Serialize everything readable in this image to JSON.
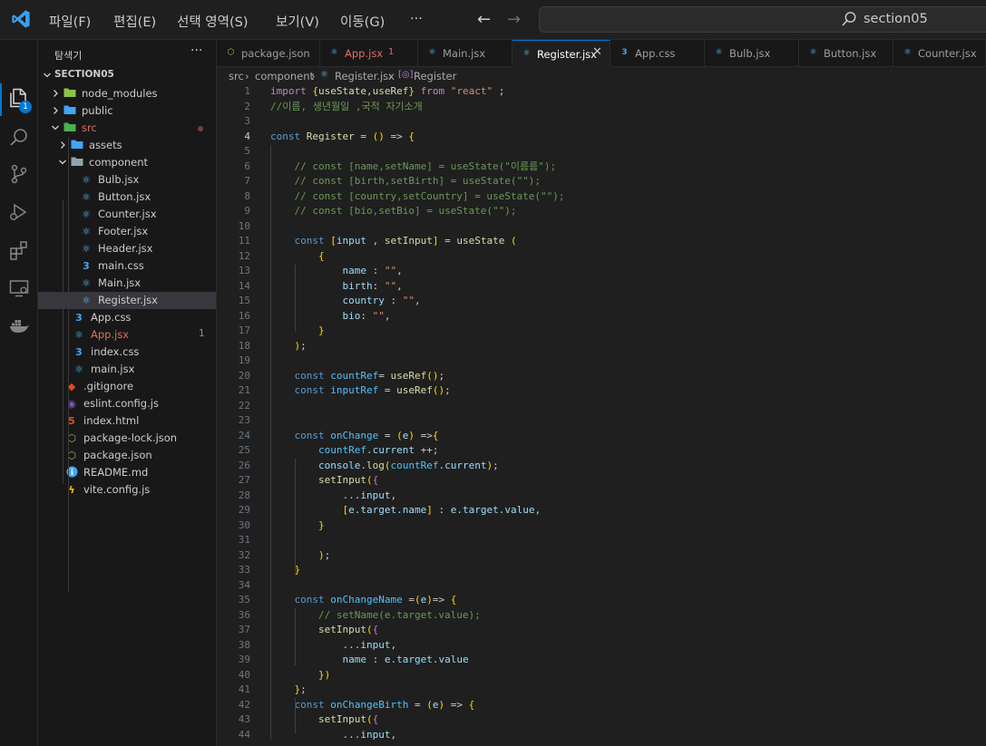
{
  "menu": [
    "파일(F)",
    "편집(E)",
    "선택 영역(S)",
    "보기(V)",
    "이동(G)",
    "···"
  ],
  "search": {
    "text": "section05"
  },
  "explorer": {
    "title": "탐색기",
    "more": "···",
    "project": "SECTION05",
    "items": [
      {
        "label": "node_modules",
        "icon": "folder-icon"
      },
      {
        "label": "public",
        "icon": "folder-icon"
      },
      {
        "label": "src",
        "icon": "folder-icon"
      },
      {
        "label": "assets",
        "icon": "folder-icon"
      },
      {
        "label": "component",
        "icon": "folder-icon"
      },
      {
        "label": "Bulb.jsx",
        "icon": "react-icon"
      },
      {
        "label": "Button.jsx",
        "icon": "react-icon"
      },
      {
        "label": "Counter.jsx",
        "icon": "react-icon"
      },
      {
        "label": "Footer.jsx",
        "icon": "react-icon"
      },
      {
        "label": "Header.jsx",
        "icon": "react-icon"
      },
      {
        "label": "main.css",
        "icon": "css-icon"
      },
      {
        "label": "Main.jsx",
        "icon": "react-icon"
      },
      {
        "label": "Register.jsx",
        "icon": "react-icon"
      },
      {
        "label": "App.css",
        "icon": "css-icon"
      },
      {
        "label": "App.jsx",
        "icon": "react-icon",
        "badge": "1"
      },
      {
        "label": "index.css",
        "icon": "css-icon"
      },
      {
        "label": "main.jsx",
        "icon": "react-icon"
      },
      {
        "label": ".gitignore",
        "icon": "git-icon"
      },
      {
        "label": "eslint.config.js",
        "icon": "eslint-icon"
      },
      {
        "label": "index.html",
        "icon": "html-icon"
      },
      {
        "label": "package-lock.json",
        "icon": "npm-icon"
      },
      {
        "label": "package.json",
        "icon": "npm-icon"
      },
      {
        "label": "README.md",
        "icon": "info-icon"
      },
      {
        "label": "vite.config.js",
        "icon": "vite-icon"
      }
    ]
  },
  "tabs": [
    {
      "label": "package.json",
      "icon": "npm-icon"
    },
    {
      "label": "App.jsx",
      "icon": "react-icon",
      "badge": "1"
    },
    {
      "label": "Main.jsx",
      "icon": "react-icon"
    },
    {
      "label": "Register.jsx",
      "icon": "react-icon",
      "active": true,
      "close": "✕"
    },
    {
      "label": "App.css",
      "icon": "css-icon"
    },
    {
      "label": "Bulb.jsx",
      "icon": "react-icon"
    },
    {
      "label": "Button.jsx",
      "icon": "react-icon"
    },
    {
      "label": "Counter.jsx",
      "icon": "react-icon"
    }
  ],
  "breadcrumb": [
    "src",
    "component",
    "Register.jsx",
    "Register"
  ],
  "activity_badge": "1",
  "colors": {
    "accent": "#0078d4",
    "react": "#4fc3f7",
    "css": "#4f8ff7",
    "error": "#e06c60"
  },
  "code": [
    "import {useState,useRef} from \"react\" ;",
    "//이름, 생년월일 ,국적 자기소개",
    "",
    "const Register = () => {",
    "",
    "    // const [name,setName] = useState(\"이름름\");",
    "    // const [birth,setBirth] = useState(\"\");",
    "    // const [country,setCountry] = useState(\"\");",
    "    // const [bio,setBio] = useState(\"\");",
    "",
    "    const [input , setInput] = useState (",
    "        {",
    "            name : \"\",",
    "            birth: \"\",",
    "            country : \"\",",
    "            bio: \"\",",
    "        }",
    "    );",
    "",
    "    const countRef= useRef();",
    "    const inputRef = useRef();",
    "",
    "",
    "    const onChange = (e) =>{",
    "        countRef.current ++;",
    "        console.log(countRef.current);",
    "        setInput({",
    "            ...input,",
    "            [e.target.name] : e.target.value,",
    "        }",
    "",
    "        );",
    "    }",
    "",
    "    const onChangeName =(e)=> {",
    "        // setName(e.target.value);",
    "        setInput({",
    "            ...input,",
    "            name : e.target.value",
    "        })",
    "    };",
    "    const onChangeBirth = (e) => {",
    "        setInput({",
    "            ...input,"
  ]
}
